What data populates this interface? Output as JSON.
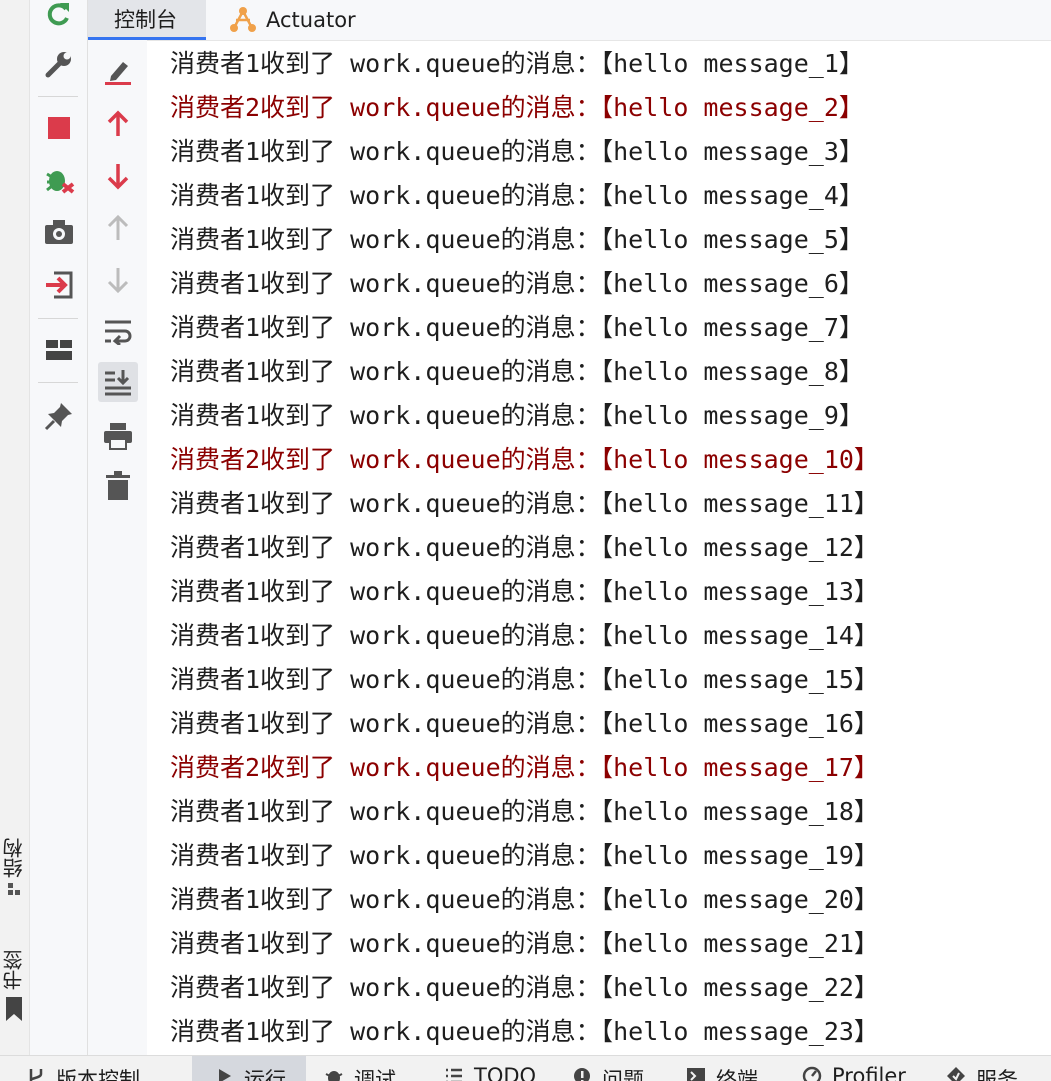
{
  "tabs": {
    "console_label": "控制台",
    "actuator_label": "Actuator"
  },
  "side_tabs": {
    "structure_label": "结构",
    "bookmarks_label": "书签"
  },
  "run_toolbar": {
    "icons": [
      "rerun-icon",
      "wrench-icon",
      "stop-icon",
      "debug-icon",
      "camera-icon",
      "exit-icon",
      "layout-icon",
      "pin-icon"
    ]
  },
  "console_toolbar": {
    "icons": [
      "clear-edit-icon",
      "up-arrow-icon",
      "down-arrow-icon",
      "up-arrow-disabled-icon",
      "down-arrow-disabled-icon",
      "soft-wrap-icon",
      "scroll-to-end-icon",
      "print-icon",
      "trash-icon"
    ],
    "active": "scroll-to-end-icon"
  },
  "console": {
    "colors": {
      "normal": "#1e1e1e",
      "highlight": "#8b0000"
    },
    "lines": [
      {
        "text": "消费者1收到了 work.queue的消息：【hello message_1】",
        "highlight": false
      },
      {
        "text": "消费者2收到了 work.queue的消息：【hello message_2】",
        "highlight": true
      },
      {
        "text": "消费者1收到了 work.queue的消息：【hello message_3】",
        "highlight": false
      },
      {
        "text": "消费者1收到了 work.queue的消息：【hello message_4】",
        "highlight": false
      },
      {
        "text": "消费者1收到了 work.queue的消息：【hello message_5】",
        "highlight": false
      },
      {
        "text": "消费者1收到了 work.queue的消息：【hello message_6】",
        "highlight": false
      },
      {
        "text": "消费者1收到了 work.queue的消息：【hello message_7】",
        "highlight": false
      },
      {
        "text": "消费者1收到了 work.queue的消息：【hello message_8】",
        "highlight": false
      },
      {
        "text": "消费者1收到了 work.queue的消息：【hello message_9】",
        "highlight": false
      },
      {
        "text": "消费者2收到了 work.queue的消息：【hello message_10】",
        "highlight": true
      },
      {
        "text": "消费者1收到了 work.queue的消息：【hello message_11】",
        "highlight": false
      },
      {
        "text": "消费者1收到了 work.queue的消息：【hello message_12】",
        "highlight": false
      },
      {
        "text": "消费者1收到了 work.queue的消息：【hello message_13】",
        "highlight": false
      },
      {
        "text": "消费者1收到了 work.queue的消息：【hello message_14】",
        "highlight": false
      },
      {
        "text": "消费者1收到了 work.queue的消息：【hello message_15】",
        "highlight": false
      },
      {
        "text": "消费者1收到了 work.queue的消息：【hello message_16】",
        "highlight": false
      },
      {
        "text": "消费者2收到了 work.queue的消息：【hello message_17】",
        "highlight": true
      },
      {
        "text": "消费者1收到了 work.queue的消息：【hello message_18】",
        "highlight": false
      },
      {
        "text": "消费者1收到了 work.queue的消息：【hello message_19】",
        "highlight": false
      },
      {
        "text": "消费者1收到了 work.queue的消息：【hello message_20】",
        "highlight": false
      },
      {
        "text": "消费者1收到了 work.queue的消息：【hello message_21】",
        "highlight": false
      },
      {
        "text": "消费者1收到了 work.queue的消息：【hello message_22】",
        "highlight": false
      },
      {
        "text": "消费者1收到了 work.queue的消息：【hello message_23】",
        "highlight": false
      }
    ]
  },
  "bottom_bar": {
    "items": [
      {
        "label": "版本控制",
        "icon": "branch-icon",
        "active": false
      },
      {
        "label": "运行",
        "icon": "run-icon",
        "active": true
      },
      {
        "label": "调试",
        "icon": "bug-icon",
        "active": false
      },
      {
        "label": "TODO",
        "icon": "todo-icon",
        "active": false
      },
      {
        "label": "问题",
        "icon": "problems-icon",
        "active": false
      },
      {
        "label": "终端",
        "icon": "terminal-icon",
        "active": false
      },
      {
        "label": "Profiler",
        "icon": "profiler-icon",
        "active": false
      },
      {
        "label": "服务",
        "icon": "services-icon",
        "active": false
      }
    ]
  }
}
